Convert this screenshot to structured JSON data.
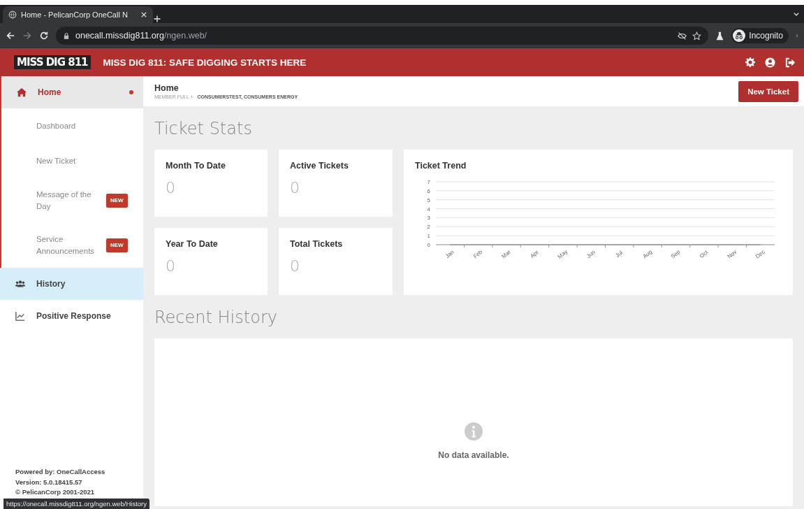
{
  "browser": {
    "tab_title": "Home - PelicanCorp OneCall N",
    "url_host": "onecall.missdig811.org",
    "url_path": "/ngen.web/",
    "profile": "Incognito"
  },
  "header": {
    "logo": "MISS DIG 811",
    "tagline": "MISS DIG 811: SAFE DIGGING STARTS HERE"
  },
  "sidebar": {
    "items": [
      {
        "label": "Home",
        "kind": "section",
        "selected": false,
        "expanded": true,
        "dot": true,
        "children": [
          {
            "label": "Dashboard"
          },
          {
            "label": "New Ticket"
          },
          {
            "label": "Message of the Day",
            "badge": "NEW"
          },
          {
            "label": "Service Announcements",
            "badge": "NEW"
          }
        ]
      },
      {
        "label": "History",
        "kind": "section",
        "selected": true,
        "expanded": false,
        "dot": false
      },
      {
        "label": "Positive Response",
        "kind": "section",
        "selected": false,
        "expanded": false,
        "dot": false
      }
    ],
    "footer": [
      "Powered by: OneCallAccess",
      "Version: 5.0.18415.57",
      "© PelicanCorp 2001-2021"
    ]
  },
  "page": {
    "title": "Home",
    "subtitle_role": "MEMBER FULL +",
    "subtitle_account": "CONSUMERSTEST, CONSUMERS ENERGY",
    "new_ticket_button": "New Ticket"
  },
  "ticket_stats": {
    "title": "Ticket Stats",
    "cards": [
      {
        "label": "Month To Date",
        "value": "0"
      },
      {
        "label": "Active Tickets",
        "value": "0"
      },
      {
        "label": "Year To Date",
        "value": "0"
      },
      {
        "label": "Total Tickets",
        "value": "0"
      }
    ],
    "trend": {
      "title": "Ticket Trend",
      "chart_data": {
        "type": "line",
        "categories": [
          "Jan",
          "Feb",
          "Mar",
          "Apr",
          "May",
          "Jun",
          "Jul",
          "Aug",
          "Sep",
          "Oct",
          "Nov",
          "Dec"
        ],
        "series": [
          {
            "values": [
              0,
              0,
              0,
              0,
              0,
              0,
              0,
              0,
              0,
              0,
              0,
              0
            ]
          }
        ],
        "grid": true,
        "ylim": [
          0,
          7
        ],
        "yticks": [
          0,
          1,
          2,
          3,
          4,
          5,
          6,
          7
        ]
      }
    }
  },
  "recent_history": {
    "title": "Recent History",
    "empty_message": "No data available."
  },
  "status_url": "https://onecall.missdig811.org/ngen.web/History"
}
